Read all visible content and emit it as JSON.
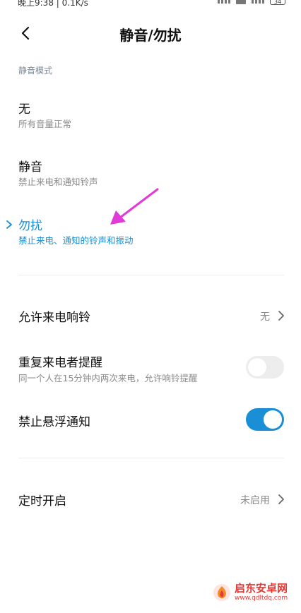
{
  "status_bar": {
    "text": "晚上9:38 | 0.1K/s",
    "battery": "34"
  },
  "header": {
    "title": "静音/勿扰"
  },
  "section": {
    "label": "静音模式"
  },
  "modes": [
    {
      "title": "无",
      "subtitle": "所有音量正常",
      "selected": false
    },
    {
      "title": "静音",
      "subtitle": "禁止来电和通知铃声",
      "selected": false
    },
    {
      "title": "勿扰",
      "subtitle": "禁止来电、通知的铃声和振动",
      "selected": true
    }
  ],
  "settings": {
    "allow_calls": {
      "label": "允许来电响铃",
      "value": "无"
    },
    "repeat_callers": {
      "label": "重复来电者提醒",
      "subtitle": "同一个人在15分钟内两次来电，允许响铃提醒",
      "enabled": false
    },
    "block_floating": {
      "label": "禁止悬浮通知",
      "enabled": true
    },
    "schedule": {
      "label": "定时开启",
      "value": "未启用"
    }
  },
  "colors": {
    "accent": "#1a8fd6",
    "annotation_arrow": "#e23ad8",
    "watermark": "#e53935"
  },
  "watermark": {
    "name": "启东安卓网",
    "url": "www.qdltdq.com"
  }
}
